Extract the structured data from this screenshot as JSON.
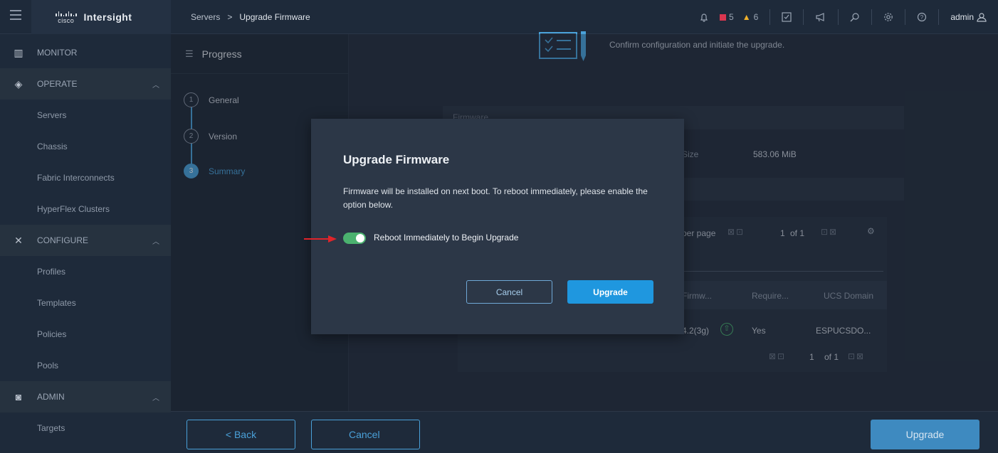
{
  "header": {
    "app_name": "Intersight",
    "logo_text": "cisco",
    "breadcrumb_parent": "Servers",
    "breadcrumb_sep": ">",
    "breadcrumb_current": "Upgrade Firmware",
    "alerts_critical_count": "5",
    "alerts_warning_count": "6",
    "user": "admin"
  },
  "sidebar": {
    "items": [
      {
        "label": "MONITOR",
        "icon": "monitor-icon"
      },
      {
        "label": "OPERATE",
        "icon": "operate-icon"
      },
      {
        "label": "Servers"
      },
      {
        "label": "Chassis"
      },
      {
        "label": "Fabric Interconnects"
      },
      {
        "label": "HyperFlex Clusters"
      },
      {
        "label": "CONFIGURE",
        "icon": "configure-icon"
      },
      {
        "label": "Profiles"
      },
      {
        "label": "Templates"
      },
      {
        "label": "Policies"
      },
      {
        "label": "Pools"
      },
      {
        "label": "ADMIN",
        "icon": "admin-icon"
      },
      {
        "label": "Targets"
      }
    ]
  },
  "progress": {
    "title": "Progress",
    "steps": [
      {
        "num": "1",
        "label": "General"
      },
      {
        "num": "2",
        "label": "Version"
      },
      {
        "num": "3",
        "label": "Summary"
      }
    ]
  },
  "summary": {
    "confirm_text": "Confirm configuration and initiate the upgrade.",
    "firmware_heading": "Firmware",
    "size_label": "Size",
    "size_value": "583.06 MiB",
    "per_page_label": "per page",
    "page_current": "1",
    "page_total": "of 1",
    "col_firmware": "Firmw...",
    "col_required": "Require...",
    "col_domain": "UCS Domain",
    "row_firmware": "4.2(3g)",
    "row_required": "Yes",
    "row_domain": "ESPUCSDO...",
    "bottom_page_current": "1",
    "bottom_page_total": "of 1"
  },
  "footer": {
    "back_label": "< Back",
    "cancel_label": "Cancel",
    "upgrade_label": "Upgrade"
  },
  "modal": {
    "title": "Upgrade Firmware",
    "message": "Firmware will be installed on next boot. To reboot immediately, please enable the option below.",
    "toggle_label": "Reboot Immediately to Begin Upgrade",
    "toggle_on": true,
    "cancel_label": "Cancel",
    "upgrade_label": "Upgrade"
  },
  "colors": {
    "accent": "#4aa1d9",
    "toggle_on": "#4bb26f",
    "critical": "#d9364f",
    "warning": "#f0b12b",
    "arrow": "#e0242a"
  }
}
